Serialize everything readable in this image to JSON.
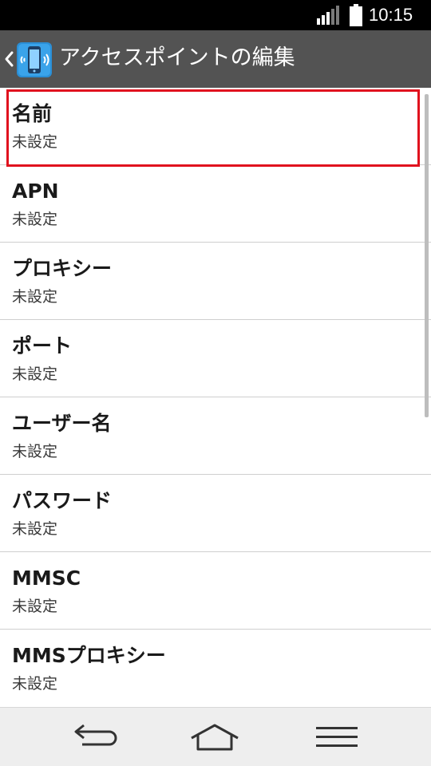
{
  "status_bar": {
    "time": "10:15",
    "signal_icon": "signal-strength-icon",
    "battery_icon": "battery-full-icon"
  },
  "action_bar": {
    "back_icon": "chevron-left-icon",
    "app_icon": "mobile-network-settings-icon",
    "title": "アクセスポイントの編集"
  },
  "list": {
    "items": [
      {
        "title": "名前",
        "summary": "未設定"
      },
      {
        "title": "APN",
        "summary": "未設定"
      },
      {
        "title": "プロキシー",
        "summary": "未設定"
      },
      {
        "title": "ポート",
        "summary": "未設定"
      },
      {
        "title": "ユーザー名",
        "summary": "未設定"
      },
      {
        "title": "パスワード",
        "summary": "未設定"
      },
      {
        "title": "MMSC",
        "summary": "未設定"
      },
      {
        "title": "MMSプロキシー",
        "summary": "未設定"
      }
    ]
  },
  "nav_bar": {
    "back_icon": "back-arrow-icon",
    "home_icon": "home-icon",
    "menu_icon": "menu-icon"
  },
  "colors": {
    "highlight": "#e0121e",
    "action_bar": "#535353",
    "status_bar": "#000000",
    "nav_bar": "#eeeeee"
  }
}
